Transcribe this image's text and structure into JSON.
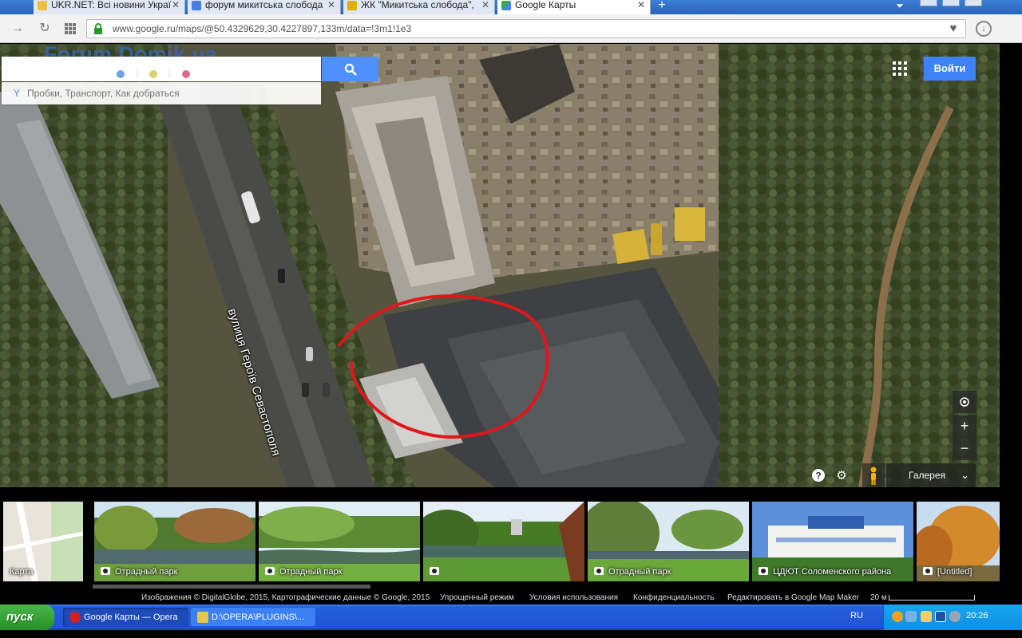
{
  "browser": {
    "tabs": [
      {
        "title": "UKR.NET: Всі новини України",
        "color": "#f0c040"
      },
      {
        "title": "форум микитська слобода",
        "color": "#4a7fe0"
      },
      {
        "title": "ЖК \"Микитська слобода\",",
        "color": "#e0b000"
      },
      {
        "title": "Google Карты",
        "color": "#34a853"
      }
    ],
    "url": "www.google.ru/maps/@50.4329629,30.4227897,133m/data=!3m1!1e3"
  },
  "map": {
    "watermark": "Forum.Domik.ua",
    "search": {
      "suggestions": "Пробки, Транспорт, Как добраться"
    },
    "signin_label": "Войти",
    "street_label": "вулиця Героїв Севастополя",
    "gallery_label": "Галерея",
    "zoom_in": "+",
    "zoom_out": "−",
    "colors": {
      "accent": "#4d90fe",
      "annotation": "#e0161b"
    }
  },
  "photos": [
    {
      "label": "Карта",
      "has_camera": false
    },
    {
      "label": "Отрадный парк",
      "has_camera": true
    },
    {
      "label": "Отрадный парк",
      "has_camera": true
    },
    {
      "label": "",
      "has_camera": true
    },
    {
      "label": "Отрадный парк",
      "has_camera": true
    },
    {
      "label": "ЦДЮТ Соломенского района",
      "has_camera": true
    },
    {
      "label": "[Untitled]",
      "has_camera": true
    }
  ],
  "attribution": {
    "imagery": "Изображения © DigitalGlobe, 2015, Картографические данные © Google, 2015",
    "simple_mode": "Упрощенный режим",
    "terms": "Условия использования",
    "privacy": "Конфиденциальность",
    "edit": "Редактировать в Google Map Maker",
    "scale": "20 м"
  },
  "taskbar": {
    "start_label": "пуск",
    "windows": [
      {
        "title": "Google Карты — Opera",
        "active": true
      },
      {
        "title": "D:\\OPERA\\PLUGINS\\...",
        "active": false
      }
    ],
    "language": "RU",
    "time": "20:26"
  }
}
